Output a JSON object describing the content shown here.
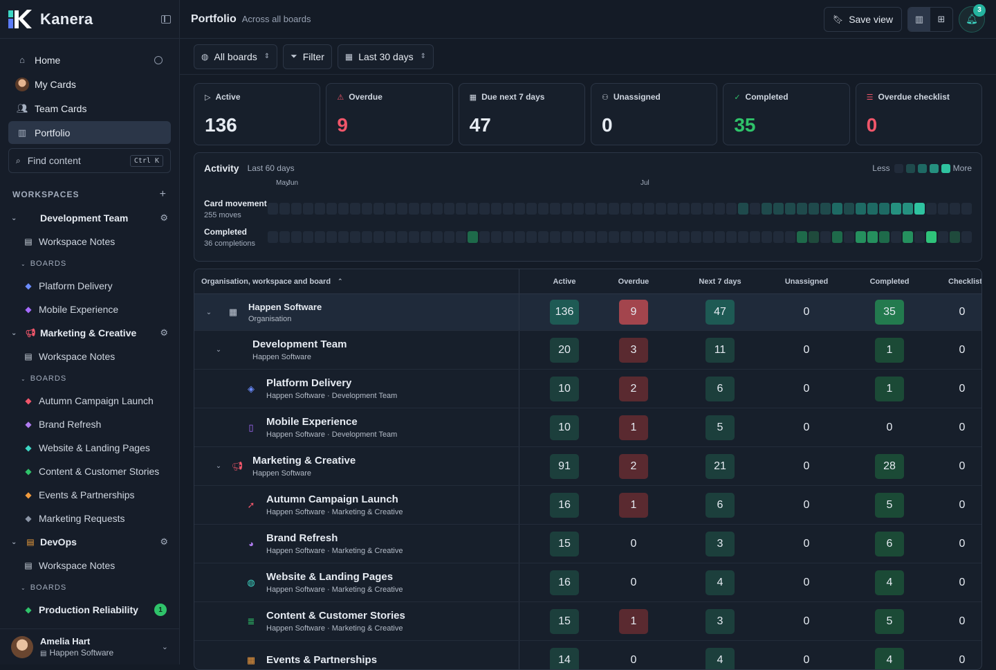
{
  "app": {
    "name": "Kanera"
  },
  "nav": [
    {
      "label": "Home",
      "icon": "home-icon"
    },
    {
      "label": "My Cards",
      "icon": "avatar"
    },
    {
      "label": "Team Cards",
      "icon": "users-icon"
    },
    {
      "label": "Portfolio",
      "icon": "chart-icon",
      "active": true
    }
  ],
  "search": {
    "placeholder": "Find content",
    "shortcut": "Ctrl K"
  },
  "workspaces_label": "WORKSPACES",
  "boards_label": "BOARDS",
  "workspace_notes_label": "Workspace Notes",
  "workspaces": [
    {
      "name": "Development Team",
      "color": "#5b8cf6",
      "icon": "code-icon",
      "boards": [
        {
          "name": "Platform Delivery",
          "color": "#6b8cff"
        },
        {
          "name": "Mobile Experience",
          "color": "#a66bff"
        }
      ]
    },
    {
      "name": "Marketing & Creative",
      "color": "#f0566a",
      "icon": "megaphone-icon",
      "boards": [
        {
          "name": "Autumn Campaign Launch",
          "color": "#f0566a"
        },
        {
          "name": "Brand Refresh",
          "color": "#b07cf0"
        },
        {
          "name": "Website & Landing Pages",
          "color": "#3dd6c4"
        },
        {
          "name": "Content & Customer Stories",
          "color": "#2fc36a"
        },
        {
          "name": "Events & Partnerships",
          "color": "#f09a3d"
        },
        {
          "name": "Marketing Requests",
          "color": "#8b95a6"
        }
      ]
    },
    {
      "name": "DevOps",
      "color": "#f0a03d",
      "icon": "server-icon",
      "boards": [
        {
          "name": "Production Reliability",
          "color": "#2fc36a",
          "badge": "1"
        }
      ]
    }
  ],
  "user": {
    "name": "Amelia Hart",
    "org": "Happen Software"
  },
  "header": {
    "title": "Portfolio",
    "subtitle": "Across all boards",
    "save_label": "Save view",
    "notif_count": "3"
  },
  "filters": {
    "boards": "All boards",
    "filter": "Filter",
    "range": "Last 30 days"
  },
  "stats": [
    {
      "label": "Active",
      "value": "136",
      "color": "#e6ebf2",
      "icon": "play-icon"
    },
    {
      "label": "Overdue",
      "value": "9",
      "color": "#f0566a",
      "icon": "warning-icon"
    },
    {
      "label": "Due next 7 days",
      "value": "47",
      "color": "#e6ebf2",
      "icon": "calendar-icon"
    },
    {
      "label": "Unassigned",
      "value": "0",
      "color": "#e6ebf2",
      "icon": "user-icon"
    },
    {
      "label": "Completed",
      "value": "35",
      "color": "#2fc36a",
      "icon": "check-icon"
    },
    {
      "label": "Overdue checklist",
      "value": "0",
      "color": "#f0566a",
      "icon": "list-icon"
    }
  ],
  "activity": {
    "title": "Activity",
    "subtitle": "Last 60 days",
    "less": "Less",
    "more": "More",
    "months": [
      {
        "label": "May",
        "col": 0
      },
      {
        "label": "Jun",
        "col": 1
      },
      {
        "label": "Jul",
        "col": 31
      }
    ],
    "rows": [
      {
        "label": "Card movement",
        "sub": "255 moves",
        "levels": [
          0,
          0,
          0,
          0,
          0,
          0,
          0,
          0,
          0,
          0,
          0,
          0,
          0,
          0,
          0,
          0,
          0,
          0,
          0,
          0,
          0,
          0,
          0,
          0,
          0,
          0,
          0,
          0,
          0,
          0,
          0,
          0,
          0,
          0,
          0,
          0,
          0,
          0,
          0,
          0,
          1,
          0,
          1,
          1,
          1,
          1,
          1,
          1,
          2,
          1,
          2,
          2,
          2,
          3,
          3,
          4,
          0,
          0,
          0,
          0
        ]
      },
      {
        "label": "Completed",
        "sub": "36 completions",
        "levels": [
          0,
          0,
          0,
          0,
          0,
          0,
          0,
          0,
          0,
          0,
          0,
          0,
          0,
          0,
          0,
          0,
          0,
          2,
          0,
          0,
          0,
          0,
          0,
          0,
          0,
          0,
          0,
          0,
          0,
          0,
          0,
          0,
          0,
          0,
          0,
          0,
          0,
          0,
          0,
          0,
          0,
          0,
          0,
          0,
          0,
          2,
          1,
          0,
          2,
          0,
          3,
          3,
          2,
          0,
          3,
          0,
          4,
          0,
          1,
          0
        ]
      }
    ]
  },
  "table": {
    "headers": [
      "Organisation, workspace and board",
      "Active",
      "Overdue",
      "Next 7 days",
      "Unassigned",
      "Completed",
      "Checklist"
    ],
    "rows": [
      {
        "level": 0,
        "name": "Happen Software",
        "sub": "Organisation",
        "icon": "building-icon",
        "iconColor": "#c2cad6",
        "chev": true,
        "active": "136",
        "overdue": "9",
        "next": "47",
        "unassigned": "0",
        "completed": "35",
        "checklist": "0"
      },
      {
        "level": 1,
        "name": "Development Team",
        "sub": "Happen Software",
        "icon": "code-icon",
        "iconColor": "#5b8cf6",
        "chev": true,
        "active": "20",
        "overdue": "3",
        "next": "11",
        "unassigned": "0",
        "completed": "1",
        "checklist": "0"
      },
      {
        "level": 2,
        "name": "Platform Delivery",
        "sub": "Happen Software · Development Team",
        "icon": "layers-icon",
        "iconColor": "#6b8cff",
        "active": "10",
        "overdue": "2",
        "next": "6",
        "unassigned": "0",
        "completed": "1",
        "checklist": "0"
      },
      {
        "level": 2,
        "name": "Mobile Experience",
        "sub": "Happen Software · Development Team",
        "icon": "phone-icon",
        "iconColor": "#a66bff",
        "active": "10",
        "overdue": "1",
        "next": "5",
        "unassigned": "0",
        "completed": "0",
        "checklist": "0"
      },
      {
        "level": 1,
        "name": "Marketing & Creative",
        "sub": "Happen Software",
        "icon": "megaphone-icon",
        "iconColor": "#f0566a",
        "chev": true,
        "active": "91",
        "overdue": "2",
        "next": "21",
        "unassigned": "0",
        "completed": "28",
        "checklist": "0"
      },
      {
        "level": 2,
        "name": "Autumn Campaign Launch",
        "sub": "Happen Software · Marketing & Creative",
        "icon": "rocket-icon",
        "iconColor": "#f0566a",
        "active": "16",
        "overdue": "1",
        "next": "6",
        "unassigned": "0",
        "completed": "5",
        "checklist": "0"
      },
      {
        "level": 2,
        "name": "Brand Refresh",
        "sub": "Happen Software · Marketing & Creative",
        "icon": "palette-icon",
        "iconColor": "#b07cf0",
        "active": "15",
        "overdue": "0",
        "next": "3",
        "unassigned": "0",
        "completed": "6",
        "checklist": "0"
      },
      {
        "level": 2,
        "name": "Website & Landing Pages",
        "sub": "Happen Software · Marketing & Creative",
        "icon": "globe-icon",
        "iconColor": "#3dd6c4",
        "active": "16",
        "overdue": "0",
        "next": "4",
        "unassigned": "0",
        "completed": "4",
        "checklist": "0"
      },
      {
        "level": 2,
        "name": "Content & Customer Stories",
        "sub": "Happen Software · Marketing & Creative",
        "icon": "document-icon",
        "iconColor": "#2fc36a",
        "active": "15",
        "overdue": "1",
        "next": "3",
        "unassigned": "0",
        "completed": "5",
        "checklist": "0"
      },
      {
        "level": 2,
        "name": "Events & Partnerships",
        "sub": "",
        "icon": "calendar-icon",
        "iconColor": "#f09a3d",
        "active": "14",
        "overdue": "0",
        "next": "4",
        "unassigned": "0",
        "completed": "4",
        "checklist": "0"
      }
    ]
  }
}
